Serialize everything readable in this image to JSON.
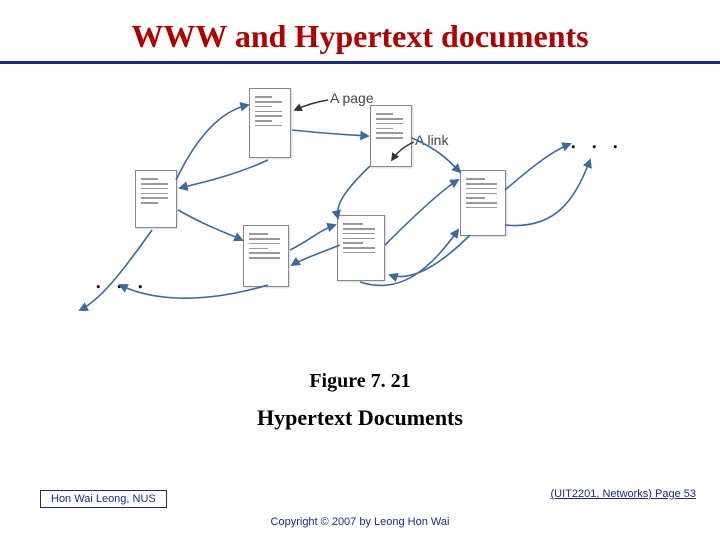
{
  "title": "WWW and Hypertext documents",
  "figure_number": "Figure 7. 21",
  "figure_caption": "Hypertext Documents",
  "annotations": {
    "page_label": "A page",
    "link_label": "A link",
    "ellipsis_left": ". . .",
    "ellipsis_right": ". . ."
  },
  "footer": {
    "author": "Hon Wai Leong, NUS",
    "copyright": "Copyright © 2007 by Leong Hon Wai",
    "course_ref": "(UIT2201, Networks) Page 53"
  },
  "diagram": {
    "description": "A set of six document pages connected by curved hyperlink arrows; one page is labeled 'A page' and one arrow is labeled 'A link'. Ellipses on the left and right indicate continuation.",
    "page_count": 6
  }
}
